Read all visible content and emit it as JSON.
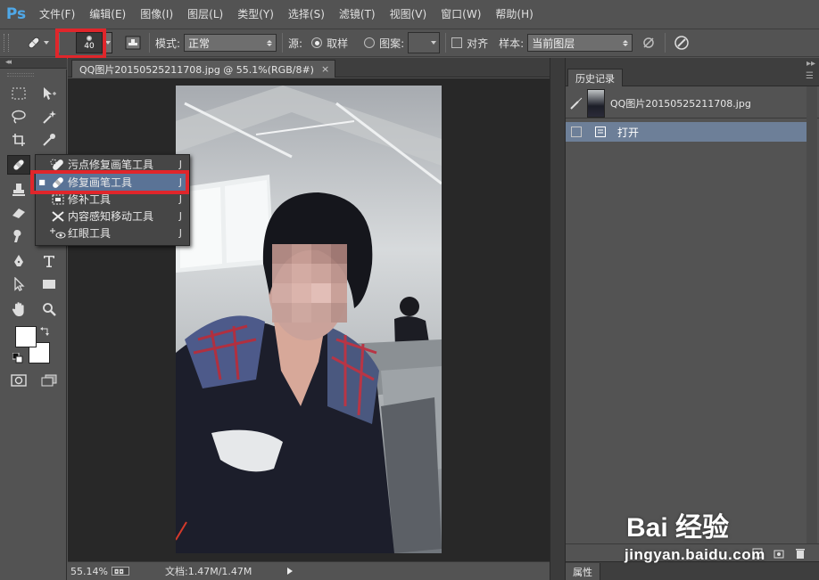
{
  "app": {
    "logo": "Ps"
  },
  "menu": [
    "文件(F)",
    "编辑(E)",
    "图像(I)",
    "图层(L)",
    "类型(Y)",
    "选择(S)",
    "滤镜(T)",
    "视图(V)",
    "窗口(W)",
    "帮助(H)"
  ],
  "options": {
    "brush_size": "40",
    "mode_label": "模式:",
    "mode_value": "正常",
    "source_label": "源:",
    "sampled_label": "取样",
    "pattern_label": "图案:",
    "align_label": "对齐",
    "sample_label": "样本:",
    "sample_value": "当前图层"
  },
  "document": {
    "tab_title": "QQ图片20150525211708.jpg @ 55.1%(RGB/8#)",
    "close": "×"
  },
  "flyout": {
    "items": [
      {
        "label": "污点修复画笔工具",
        "key": "J",
        "selected": false
      },
      {
        "label": "修复画笔工具",
        "key": "J",
        "selected": true
      },
      {
        "label": "修补工具",
        "key": "J",
        "selected": false
      },
      {
        "label": "内容感知移动工具",
        "key": "J",
        "selected": false
      },
      {
        "label": "红眼工具",
        "key": "J",
        "selected": false
      }
    ],
    "bullet": "■"
  },
  "status": {
    "zoom": "55.14%",
    "doc_info": "文档:1.47M/1.47M"
  },
  "history": {
    "tab": "历史记录",
    "snapshot_name": "QQ图片20150525211708.jpg",
    "states": [
      {
        "label": "打开"
      }
    ]
  },
  "properties": {
    "tab": "属性"
  },
  "watermark": {
    "brand": "Bai 经验",
    "url": "jingyan.baidu.com"
  },
  "colors": {
    "highlight": "#e0262b",
    "selection": "#5a7396",
    "history_selected": "#6d7f98"
  }
}
